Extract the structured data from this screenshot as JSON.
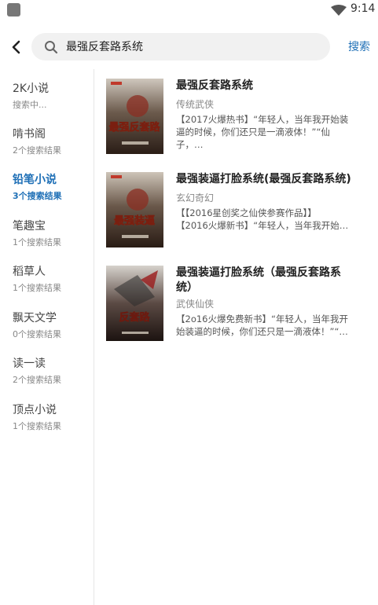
{
  "status": {
    "time": "9:14"
  },
  "search": {
    "query": "最强反套路系统",
    "button_label": "搜索"
  },
  "sources": [
    {
      "name": "2K小说",
      "status": "搜索中..."
    },
    {
      "name": "啃书阁",
      "status": "2个搜索结果"
    },
    {
      "name": "铅笔小说",
      "status": "3个搜索结果"
    },
    {
      "name": "笔趣宝",
      "status": "1个搜索结果"
    },
    {
      "name": "稻草人",
      "status": "1个搜索结果"
    },
    {
      "name": "飘天文学",
      "status": "0个搜索结果"
    },
    {
      "name": "读一读",
      "status": "2个搜索结果"
    },
    {
      "name": "顶点小说",
      "status": "1个搜索结果"
    }
  ],
  "results": [
    {
      "title": "最强反套路系统",
      "category": "传统武侠",
      "desc_lines": [
        "【2017火爆热书】“年轻人，当年我开始装",
        "逼的时候，你们还只是一滴液体！”“仙子，…"
      ],
      "cover_text": "最强反套路"
    },
    {
      "title": "最强装逼打脸系统(最强反套路系统)",
      "category": "玄幻奇幻",
      "desc_lines": [
        "【【2016星创奖之仙侠参赛作品】】",
        "【2016火爆新书】“年轻人，当年我开始…"
      ],
      "cover_text": "最强装逼"
    },
    {
      "title_lines": [
        "最强装逼打脸系统（最强反套路系",
        "统）"
      ],
      "category": "武侠仙侠",
      "desc_lines": [
        "【2o16火爆免费新书】“年轻人，当年我开",
        "始装逼的时候，你们还只是一滴液体！”“…"
      ],
      "cover_text": "反套路"
    }
  ],
  "colors": {
    "accent": "#1e6fb6"
  }
}
